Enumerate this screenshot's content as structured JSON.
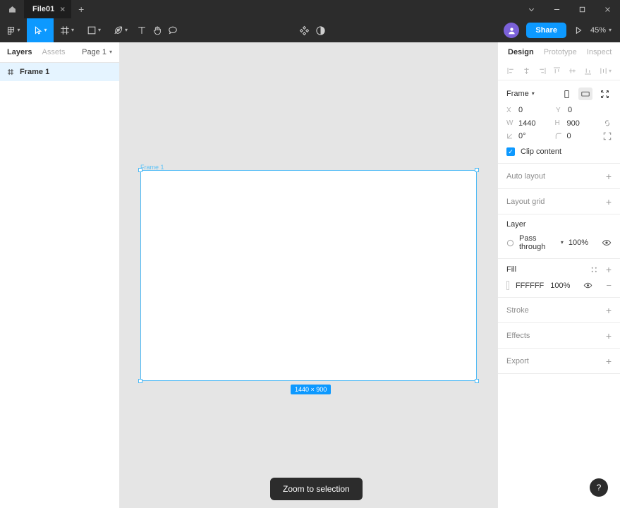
{
  "titlebar": {
    "home_icon": "home-icon",
    "tab_label": "File01",
    "tab_close": "×",
    "new_tab": "+",
    "window_chevron": "⌄",
    "window_minimize": "─",
    "window_maximize": "□",
    "window_close": "×"
  },
  "toolbar": {
    "tools": [
      {
        "name": "figma-menu-icon",
        "caret": true
      },
      {
        "name": "move-tool-icon",
        "caret": true
      },
      {
        "name": "frame-tool-icon",
        "caret": true
      },
      {
        "name": "shape-tool-icon",
        "caret": true
      },
      {
        "name": "pen-tool-icon",
        "caret": true
      },
      {
        "name": "text-tool-icon",
        "caret": false
      },
      {
        "name": "hand-tool-icon",
        "caret": false
      },
      {
        "name": "comment-tool-icon",
        "caret": false
      }
    ],
    "actions": [
      {
        "name": "plugins-icon"
      },
      {
        "name": "dark-mode-icon"
      }
    ],
    "avatar": "user-avatar",
    "share_label": "Share",
    "present_icon": "present-play-icon",
    "zoom_value": "45%",
    "zoom_caret": "⌄"
  },
  "left_panel": {
    "tabs": [
      {
        "label": "Layers",
        "active": true
      },
      {
        "label": "Assets",
        "active": false
      }
    ],
    "page_label": "Page 1",
    "page_caret": "⌄",
    "layers": [
      {
        "icon": "frame-icon",
        "label": "Frame 1",
        "selected": true
      }
    ]
  },
  "canvas": {
    "frame_label": "Frame 1",
    "dimension_badge": "1440 × 900",
    "tooltip": "Zoom to selection",
    "background_color": "#e5e5e5",
    "selection_color": "#0d99ff",
    "frame_fill": "#FFFFFF"
  },
  "right_panel": {
    "tabs": [
      {
        "label": "Design",
        "active": true
      },
      {
        "label": "Prototype",
        "active": false
      },
      {
        "label": "Inspect",
        "active": false
      }
    ],
    "align_buttons": [
      {
        "name": "align-left-icon"
      },
      {
        "name": "align-horizontal-center-icon"
      },
      {
        "name": "align-right-icon"
      },
      {
        "name": "align-top-icon"
      },
      {
        "name": "align-vertical-center-icon"
      },
      {
        "name": "align-bottom-icon"
      },
      {
        "name": "distribute-more-icon"
      }
    ],
    "frame_section": {
      "type_label": "Frame",
      "type_caret": "⌄",
      "portrait_icon": "orientation-portrait-icon",
      "landscape_icon": "orientation-landscape-icon",
      "resize_icon": "resize-to-fit-icon",
      "fields": {
        "x_label": "X",
        "x_value": "0",
        "y_label": "Y",
        "y_value": "0",
        "w_label": "W",
        "w_value": "1440",
        "h_label": "H",
        "h_value": "900",
        "rotation_label": "rotation-icon",
        "rotation_value": "0°",
        "corner_label": "corner-radius-icon",
        "corner_value": "0",
        "constrain_icon": "constrain-proportions-icon",
        "independent_corners_icon": "independent-corners-icon"
      },
      "clip_content_label": "Clip content",
      "clip_content_checked": true,
      "checkmark": "✓"
    },
    "auto_layout": {
      "label": "Auto layout",
      "add": "+"
    },
    "layout_grid": {
      "label": "Layout grid",
      "add": "+"
    },
    "layer": {
      "title": "Layer",
      "blend_icon": "blend-mode-icon",
      "blend_mode": "Pass through",
      "blend_caret": "⌄",
      "opacity": "100%",
      "visibility_icon": "eye-icon"
    },
    "fill": {
      "title": "Fill",
      "styles_icon": "fill-styles-icon",
      "add": "+",
      "swatch_color": "#FFFFFF",
      "hex": "FFFFFF",
      "opacity": "100%",
      "visibility_icon": "eye-icon",
      "remove": "−"
    },
    "stroke": {
      "label": "Stroke",
      "add": "+"
    },
    "effects": {
      "label": "Effects",
      "add": "+"
    },
    "export": {
      "label": "Export",
      "add": "+"
    }
  },
  "help": {
    "label": "?"
  }
}
